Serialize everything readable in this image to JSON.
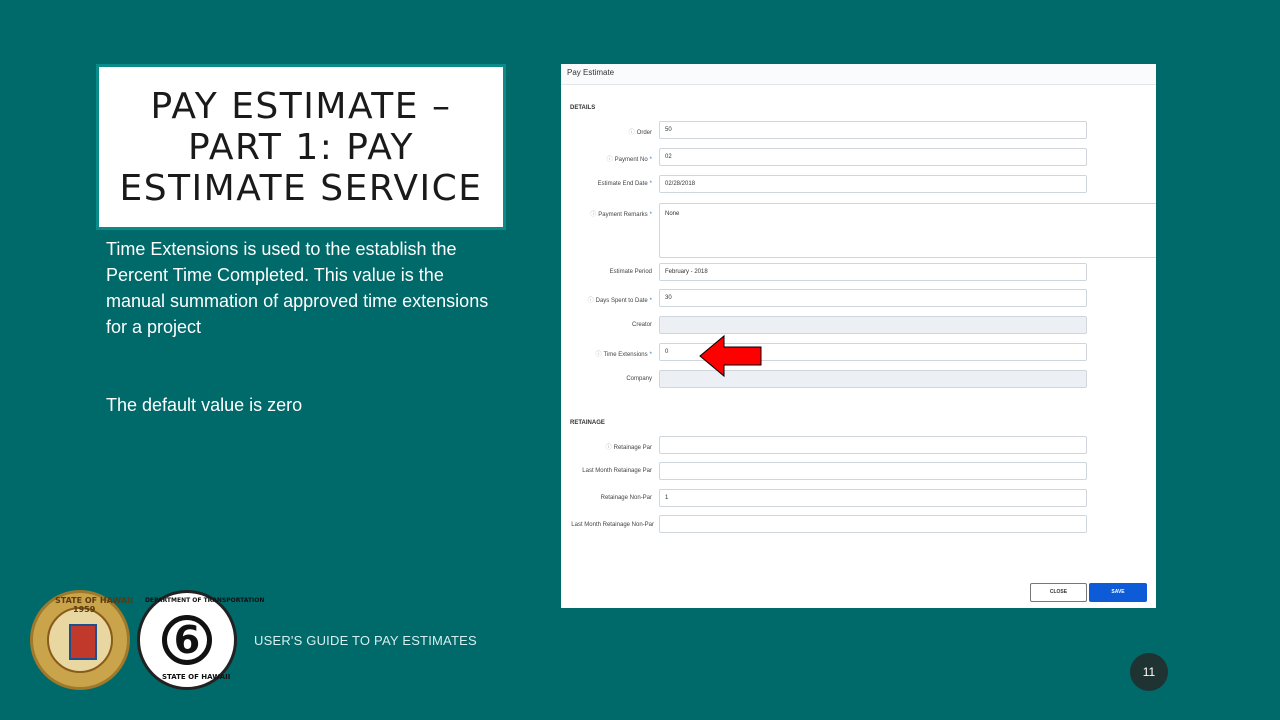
{
  "slide": {
    "title": "PAY ESTIMATE – PART 1: PAY ESTIMATE SERVICE",
    "paragraph1": "Time Extensions is used to the establish the Percent Time Completed. This value is the manual summation of approved time extensions for a project",
    "paragraph2": "The default value is zero",
    "footer": "USER'S GUIDE TO PAY ESTIMATES",
    "page_number": "11"
  },
  "seals": {
    "state_top": "STATE OF HAWAII",
    "state_year": "1959",
    "dot_top": "DEPARTMENT OF TRANSPORTATION",
    "dot_bottom": "STATE OF HAWAII",
    "dot_center": "6"
  },
  "screenshot": {
    "header": "Pay Estimate",
    "details_title": "DETAILS",
    "retainage_title": "RETAINAGE",
    "fields": {
      "order": {
        "label": "Order",
        "value": "50"
      },
      "payment_no": {
        "label": "Payment No",
        "value": "02"
      },
      "estimate_end_date": {
        "label": "Estimate End Date",
        "value": "02/28/2018"
      },
      "payment_remarks": {
        "label": "Payment Remarks",
        "value": "None"
      },
      "estimate_period": {
        "label": "Estimate Period",
        "value": "February - 2018"
      },
      "days_spent": {
        "label": "Days Spent to Date",
        "value": "30"
      },
      "creator": {
        "label": "Creator",
        "value": ""
      },
      "time_extensions": {
        "label": "Time Extensions",
        "value": "0"
      },
      "company": {
        "label": "Company",
        "value": ""
      },
      "retainage_par": {
        "label": "Retainage Par",
        "value": ""
      },
      "last_month_retainage_par": {
        "label": "Last Month Retainage Par",
        "value": ""
      },
      "retainage_non_par": {
        "label": "Retainage Non-Par",
        "value": "1"
      },
      "last_month_retainage_non_par": {
        "label": "Last Month Retainage Non-Par",
        "value": ""
      }
    },
    "close_label": "CLOSE",
    "save_label": "SAVE",
    "info_icon": "info-circle-icon",
    "arrow_color": "#ff0000",
    "save_color": "#0d5bd6"
  }
}
